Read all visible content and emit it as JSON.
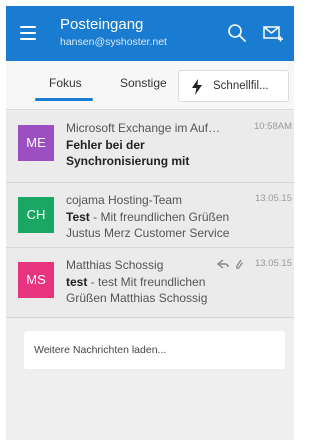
{
  "header": {
    "title": "Posteingang",
    "account": "hansen@syshoster.net",
    "icons": [
      "menu-icon",
      "search-icon",
      "compose-icon"
    ]
  },
  "tabs": {
    "items": [
      {
        "label": "Fokus",
        "active": true
      },
      {
        "label": "Sonstige",
        "active": false
      }
    ],
    "filter": {
      "label": "Schnellfil...",
      "icon": "lightning-icon"
    }
  },
  "messages": [
    {
      "initials": "ME",
      "avatar_color": "#9c4fc0",
      "sender": "Microsoft Exchange im Auftra...",
      "time": "10:58AM",
      "subject_line1": "Fehler bei der",
      "subject_line2": "Synchronisierung mit",
      "preview": ""
    },
    {
      "initials": "CH",
      "avatar_color": "#1aa663",
      "sender": "cojama Hosting-Team",
      "time": "13.05.15",
      "subject": "Test",
      "preview_line1": " - Mit freundlichen Grüßen",
      "preview_line2": "Justus Merz Customer Service"
    },
    {
      "initials": "MS",
      "avatar_color": "#e8337e",
      "sender": "Matthias Schossig",
      "time": "13.05.15",
      "subject": "test",
      "preview_line1": " - test Mit freundlichen",
      "preview_line2": "Grüßen Matthias Schossig",
      "icons": [
        "reply-icon",
        "attachment-icon"
      ]
    }
  ],
  "load_more": {
    "label": "Weitere Nachrichten laden..."
  },
  "colors": {
    "accent": "#1a7cd0"
  }
}
